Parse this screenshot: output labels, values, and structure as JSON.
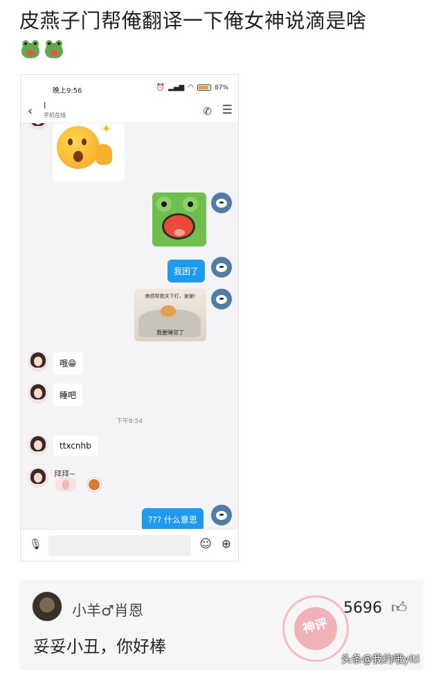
{
  "post": {
    "title": "皮燕子门帮俺翻译一下俺女神说滴是啥"
  },
  "screenshot": {
    "status_bar": {
      "time": "晚上9:56",
      "battery": "87%"
    },
    "chat_header": {
      "contact_name": "l",
      "contact_status": "手机在线"
    },
    "messages": {
      "out_text_1": "我困了",
      "meme_caption_top": "麻烦帮我关下灯，谢谢!",
      "meme_caption_bottom": "我要睡觉了",
      "in_text_1": "哦😁",
      "in_text_2": "睡吧",
      "time_divider": "下午9:54",
      "in_text_3": "ttxcnhb",
      "sticker_text": "拜拜~",
      "out_text_2": "??? 什么意思"
    }
  },
  "comment": {
    "username": "小羊♂肖恩",
    "likes": "5696",
    "text": "妥妥小丑，你好棒",
    "stamp_text": "神评",
    "watermark": "头条@我约哦yiti"
  },
  "colors": {
    "outgoing_bubble": "#1e9bf0",
    "chat_bg": "#f4f4f6"
  }
}
